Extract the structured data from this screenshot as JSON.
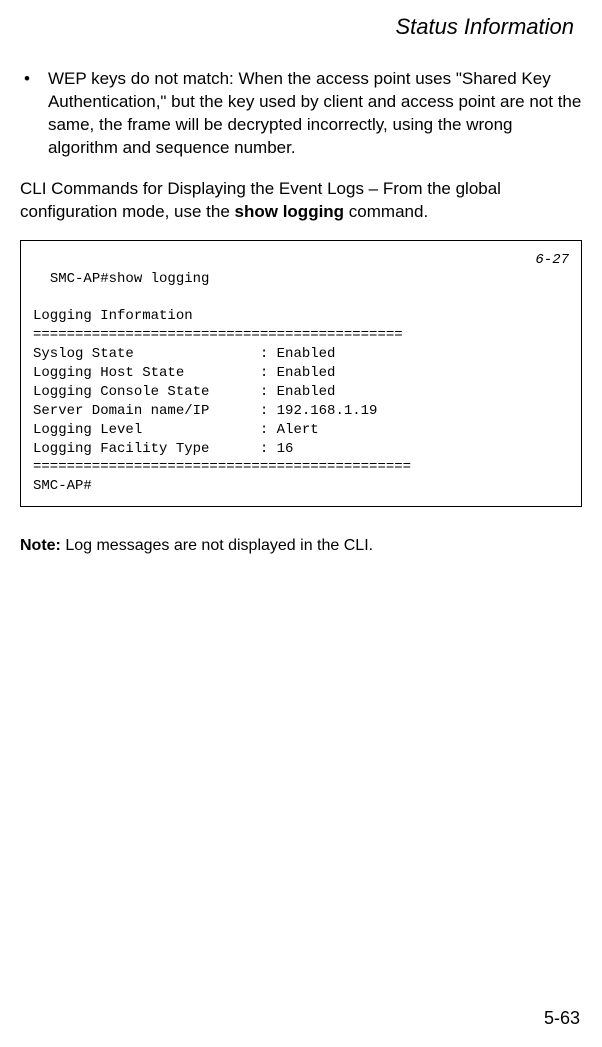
{
  "header": {
    "title": "Status Information"
  },
  "bullet": {
    "marker": "•",
    "text": "WEP keys do not match: When the access point uses \"Shared Key Authentication,\" but the key used by client and access point are not the same, the frame will be decrypted incorrectly, using the wrong algorithm and sequence number."
  },
  "paragraph": {
    "prefix": "CLI Commands for Displaying the Event Logs – From the global configuration mode, use the ",
    "bold": "show logging",
    "suffix": " command."
  },
  "code": {
    "ref": "6-27",
    "lines": "SMC-AP#show logging\n\nLogging Information\n============================================\nSyslog State               : Enabled\nLogging Host State         : Enabled\nLogging Console State      : Enabled\nServer Domain name/IP      : 192.168.1.19\nLogging Level              : Alert\nLogging Facility Type      : 16\n=============================================\nSMC-AP#"
  },
  "note": {
    "label": "Note:",
    "text": "  Log messages are not displayed in the CLI."
  },
  "page_number": "5-63"
}
